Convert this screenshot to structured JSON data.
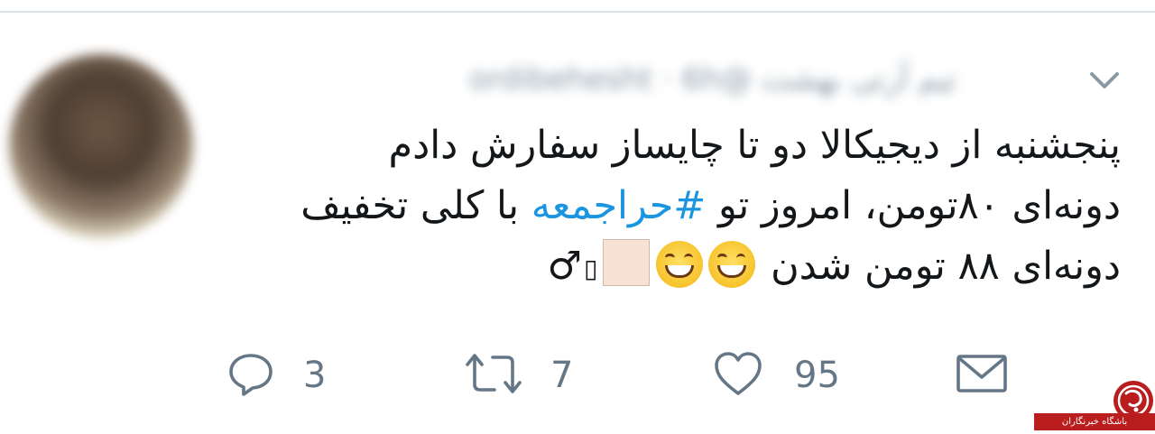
{
  "header": {
    "display_name": "تیم آرتی بهشت",
    "username": "@ordibehesht",
    "time": "6h"
  },
  "tweet": {
    "line1": "پنجشنبه از دیجیکالا دو تا چایساز سفارش دادم",
    "line2_a": "دونه‌ای ۸۰تومن، امروز تو ",
    "hashtag": "#حراجمعه",
    "line2_b": " با کلی تخفیف",
    "line3": "دونه‌ای ۸۸ تومن شدن ",
    "missing_glyph": "▯",
    "male_sign": "♂"
  },
  "actions": {
    "reply_count": "3",
    "retweet_count": "7",
    "like_count": "95"
  },
  "watermark": {
    "text": "باشگاه خبرنگاران"
  },
  "icons": {
    "chevron": "chevron-down-icon",
    "reply": "reply-icon",
    "retweet": "retweet-icon",
    "like": "heart-icon",
    "dm": "envelope-icon"
  },
  "colors": {
    "text": "#14171a",
    "hashtag": "#1b95e0",
    "icon": "#657786",
    "watermark": "#b91d1d"
  }
}
